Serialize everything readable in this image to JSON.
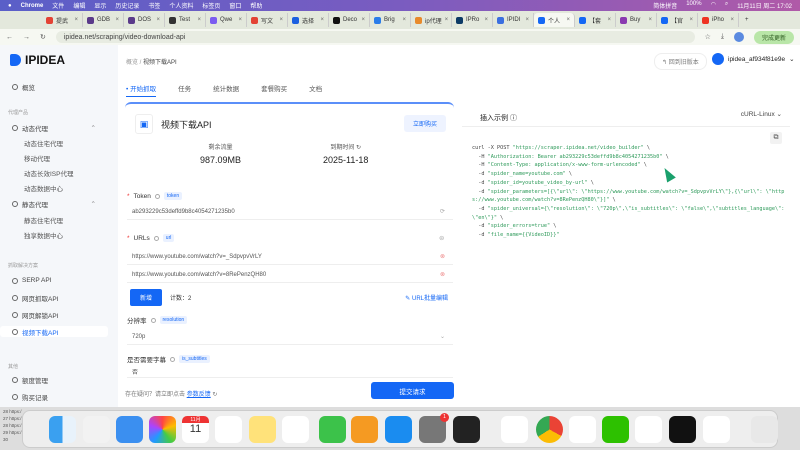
{
  "menubar": {
    "app": "Chrome",
    "items": [
      "文件",
      "编辑",
      "显示",
      "历史记录",
      "书签",
      "个人资料",
      "标签页",
      "窗口",
      "帮助"
    ],
    "input_method": "简体拼音",
    "battery": "100%",
    "datetime": "11月11日 周二 17:02"
  },
  "tabs": [
    {
      "label": "提武",
      "color": "#e34234"
    },
    {
      "label": "GDB",
      "color": "#5a3a8a"
    },
    {
      "label": "DOS",
      "color": "#5a3a8a"
    },
    {
      "label": "Test",
      "color": "#333"
    },
    {
      "label": "Qwe",
      "color": "#7b5cf0"
    },
    {
      "label": "写文",
      "color": "#e34234"
    },
    {
      "label": "选择",
      "color": "#1b5fe0"
    },
    {
      "label": "Deco",
      "color": "#111"
    },
    {
      "label": "Brig",
      "color": "#2b7de9"
    },
    {
      "label": "ip代理",
      "color": "#e88a2b"
    },
    {
      "label": "IPRo",
      "color": "#0d3b66"
    },
    {
      "label": "IPIDI",
      "color": "#3b6fe0"
    },
    {
      "label": "个人",
      "color": "#1467f5",
      "active": true
    },
    {
      "label": "【套",
      "color": "#1467f5"
    },
    {
      "label": "Buy",
      "color": "#8a3ab0"
    },
    {
      "label": "【官",
      "color": "#1467f5"
    },
    {
      "label": "iPho",
      "color": "#e32"
    }
  ],
  "address": {
    "url": "ipidea.net/scraping/video-download-api",
    "update_label": "完成更新"
  },
  "sidebar": {
    "brand": "IPIDEA",
    "overview": "概览",
    "group_proxy": "代理产品",
    "dynamic": "动态代理",
    "dynamic_items": [
      "动态住宅代理",
      "移动代理",
      "动态长效ISP代理",
      "动态数据中心"
    ],
    "static": "静态代理",
    "static_items": [
      "静态住宅代理",
      "独享数据中心"
    ],
    "group_scrape": "抓取解决方案",
    "scrape_items": [
      "SERP API",
      "网页抓取API",
      "网页解锁API",
      "视频下载API"
    ],
    "group_other": "其他",
    "other_items": [
      "额度管理",
      "购买记录"
    ]
  },
  "header": {
    "breadcrumb_root": "概览",
    "breadcrumb_current": "视频下载API",
    "old_version": "回到旧版本",
    "username": "ipidea_af934f81e9e"
  },
  "toptabs": [
    "开始抓取",
    "任务",
    "统计数据",
    "套餐购买",
    "文档"
  ],
  "product": {
    "title": "视频下载API",
    "buy": "立即购买",
    "remaining_label": "剩余流量",
    "remaining": "987.09MB",
    "expire_label": "到期时间",
    "expire": "2025-11-18"
  },
  "form": {
    "token_label": "Token",
    "token_tag": "token",
    "token_value": "ab293229c53deffd9b8c4054271235b0",
    "urls_label": "URLs",
    "urls_tag": "url",
    "urls": [
      "https://www.youtube.com/watch?v=_SdpvpvVrLY",
      "https://www.youtube.com/watch?v=8RePenzQH80"
    ],
    "add": "新增",
    "count": "计数：2",
    "batch_edit": "URL批量编辑",
    "resolution_label": "分辨率",
    "resolution_tag": "resolution",
    "resolution_value": "720p",
    "subtitle_label": "是否需要字幕",
    "subtitle_tag": "is_subtitles",
    "subtitle_value": "否",
    "help_text": "存在疑问？请立即点击",
    "feedback": "参数反馈",
    "submit": "提交请求"
  },
  "example": {
    "tab": "插入示例",
    "lang": "cURL-Linux",
    "lines": [
      [
        "curl -X POST ",
        "\"https://scraper.ipidea.net/video_builder\"",
        " \\"
      ],
      [
        "  -H ",
        "\"Authorization: Bearer ab293229c53deffd9b8c4054271235b0\"",
        " \\"
      ],
      [
        "  -H ",
        "\"Content-Type: application/x-www-form-urlencoded\"",
        " \\"
      ],
      [
        "  -d ",
        "\"spider_name=youtube.com\"",
        " \\"
      ],
      [
        "  -d ",
        "\"spider_id=youtube_video_by-url\"",
        " \\"
      ],
      [
        "  -d ",
        "\"spider_parameters=[{\\\"url\\\": \\\"https://www.youtube.com/watch?v=_SdpvpvVrLY\\\"},{\\\"url\\\": \\\"https://www.youtube.com/watch?v=8RePenzQH80\\\"}]\"",
        " \\"
      ],
      [
        "  -d ",
        "\"spider_universal={\\\"resolution\\\": \\\"720p\\\",\\\"is_subtitles\\\": \\\"false\\\",\\\"subtitles_language\\\": \\\"en\\\"}\"",
        " \\"
      ],
      [
        "  -d ",
        "\"spider_errors=true\"",
        " \\"
      ],
      [
        "  -d ",
        "\"file_name={{VideoID}}\"",
        ""
      ]
    ]
  },
  "terminal": {
    "lines": [
      "28 https:/",
      "27 https:/",
      "28 https:/",
      "29 https:/",
      "30"
    ]
  },
  "dock": {
    "calendar_month": "11月",
    "calendar_day": "11",
    "settings_badge": "1",
    "apps": [
      "finder",
      "launchpad",
      "mail",
      "photos",
      "calendar",
      "reminders",
      "notes",
      "freeform",
      "numbers",
      "pages",
      "app-store",
      "system-settings",
      "terminal",
      "typora",
      "chrome",
      "wps",
      "wechat",
      "vscode",
      "capcut",
      "rocket",
      "trash"
    ]
  }
}
